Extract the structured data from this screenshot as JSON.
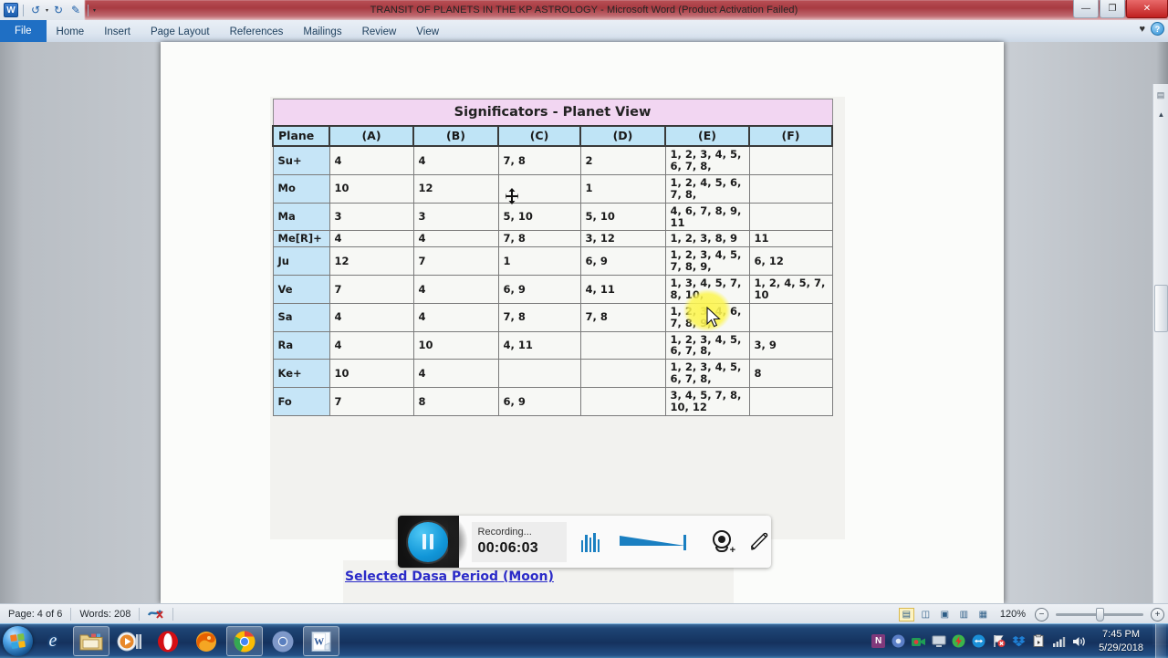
{
  "window": {
    "title": "TRANSIT OF PLANETS IN THE KP ASTROLOGY  -  Microsoft Word (Product Activation Failed)",
    "minimize": "—",
    "restore": "❐",
    "close": "✕",
    "app_badge": "W"
  },
  "quick_access": {
    "undo": "↺",
    "undo_caret": "▾",
    "redo": "↻",
    "quick_edit": "✎",
    "customize_caret": "▾"
  },
  "ribbon": {
    "tabs": [
      {
        "label": "File",
        "active": true
      },
      {
        "label": "Home",
        "active": false
      },
      {
        "label": "Insert",
        "active": false
      },
      {
        "label": "Page Layout",
        "active": false
      },
      {
        "label": "References",
        "active": false
      },
      {
        "label": "Mailings",
        "active": false
      },
      {
        "label": "Review",
        "active": false
      },
      {
        "label": "View",
        "active": false
      }
    ],
    "heart_icon": "♥",
    "help_label": "?"
  },
  "document": {
    "table": {
      "title": "Significators - Planet View",
      "columns": [
        "Plane",
        "(A)",
        "(B)",
        "(C)",
        "(D)",
        "(E)",
        "(F)"
      ],
      "rows": [
        {
          "planet": "Su+",
          "a": "4",
          "b": "4",
          "c": "7, 8",
          "d": "2",
          "e": "1, 2, 3, 4, 5, 6, 7, 8,",
          "f": ""
        },
        {
          "planet": "Mo",
          "a": "10",
          "b": "12",
          "c": "",
          "d": "1",
          "e": "1, 2, 4, 5, 6, 7, 8,",
          "f": ""
        },
        {
          "planet": "Ma",
          "a": "3",
          "b": "3",
          "c": "5, 10",
          "d": "5, 10",
          "e": "4, 6, 7, 8, 9, 11",
          "f": ""
        },
        {
          "planet": "Me[R]+",
          "a": "4",
          "b": "4",
          "c": "7, 8",
          "d": "3, 12",
          "e": "1, 2, 3, 8, 9",
          "f": "11"
        },
        {
          "planet": "Ju",
          "a": "12",
          "b": "7",
          "c": "1",
          "d": "6, 9",
          "e": "1, 2, 3, 4, 5, 7, 8, 9,",
          "f": "6, 12"
        },
        {
          "planet": "Ve",
          "a": "7",
          "b": "4",
          "c": "6, 9",
          "d": "4, 11",
          "e": "1, 3, 4, 5, 7, 8, 10,",
          "f": "1, 2, 4, 5, 7, 10"
        },
        {
          "planet": "Sa",
          "a": "4",
          "b": "4",
          "c": "7, 8",
          "d": "7, 8",
          "e": "1, 2, 3, 4, 6, 7, 8, 9,",
          "f": ""
        },
        {
          "planet": "Ra",
          "a": "4",
          "b": "10",
          "c": "4, 11",
          "d": "",
          "e": "1, 2, 3, 4, 5, 6, 7, 8,",
          "f": "3, 9"
        },
        {
          "planet": "Ke+",
          "a": "10",
          "b": "4",
          "c": "",
          "d": "",
          "e": "1, 2, 3, 4, 5, 6, 7, 8,",
          "f": "8"
        },
        {
          "planet": "Fo",
          "a": "7",
          "b": "8",
          "c": "6, 9",
          "d": "",
          "e": "3, 4, 5, 7, 8, 10, 12",
          "f": ""
        }
      ]
    },
    "dasa_link": "Selected Dasa Period (Moon)"
  },
  "recorder": {
    "status": "Recording...",
    "elapsed": "00:06:03",
    "pause_icon": "pause",
    "levels_icon": "audio-levels",
    "volume_icon": "volume-slider",
    "webcam_icon": "webcam-add",
    "pen_icon": "pencil"
  },
  "status_bar": {
    "page": "Page: 4 of 6",
    "words": "Words: 208",
    "proofing_icon": "spellcheck-error",
    "views": [
      {
        "name": "print-layout",
        "glyph": "▤",
        "active": true
      },
      {
        "name": "full-screen-reading",
        "glyph": "◫",
        "active": false
      },
      {
        "name": "web-layout",
        "glyph": "▣",
        "active": false
      },
      {
        "name": "outline",
        "glyph": "▥",
        "active": false
      },
      {
        "name": "draft",
        "glyph": "▦",
        "active": false
      }
    ],
    "zoom": "120%",
    "zoom_out": "−",
    "zoom_in": "+"
  },
  "taskbar": {
    "start_label": "Start",
    "items": [
      {
        "name": "internet-explorer-icon",
        "glyph": "e",
        "color": "#3a8fd8",
        "pinned": false
      },
      {
        "name": "file-explorer-icon",
        "glyph": "🗀",
        "color": "#e8c36a",
        "pinned": true
      },
      {
        "name": "media-player-icon",
        "glyph": "▶",
        "color": "#e07b20",
        "pinned": false
      },
      {
        "name": "opera-icon",
        "glyph": "O",
        "color": "#d40f14",
        "pinned": false
      },
      {
        "name": "firefox-icon",
        "glyph": "🦊",
        "color": "#e66000",
        "pinned": false
      },
      {
        "name": "chrome-icon",
        "glyph": "◉",
        "color": "#2fa84f",
        "pinned": true
      },
      {
        "name": "chromium-icon",
        "glyph": "◉",
        "color": "#6f8fd0",
        "pinned": false
      },
      {
        "name": "word-icon",
        "glyph": "W",
        "color": "#2b579a",
        "pinned": true
      }
    ],
    "tray": [
      {
        "name": "onenote-tray-icon",
        "glyph": "N",
        "color": "#80397b"
      },
      {
        "name": "chromium-tray-icon",
        "glyph": "◉",
        "color": "#5b7fc7"
      },
      {
        "name": "camtasia-tray-icon",
        "glyph": "●",
        "color": "#1f9d55"
      },
      {
        "name": "display-tray-icon",
        "glyph": "🖵",
        "color": "#cfd6de"
      },
      {
        "name": "security-tray-icon",
        "glyph": "✦",
        "color": "#3cb54a"
      },
      {
        "name": "teamviewer-tray-icon",
        "glyph": "↔",
        "color": "#1a8fd8"
      },
      {
        "name": "action-center-icon",
        "glyph": "⚑",
        "color": "#e8e8e8"
      },
      {
        "name": "dropbox-tray-icon",
        "glyph": "❖",
        "color": "#1f7fd4"
      },
      {
        "name": "clipboard-tray-icon",
        "glyph": "📋",
        "color": "#dde3ea"
      },
      {
        "name": "network-tray-icon",
        "glyph": "▁▃▅",
        "color": "#e8e8e8"
      },
      {
        "name": "volume-tray-icon",
        "glyph": "🔊",
        "color": "#e8e8e8"
      }
    ],
    "time": "7:45 PM",
    "date": "5/29/2018"
  }
}
